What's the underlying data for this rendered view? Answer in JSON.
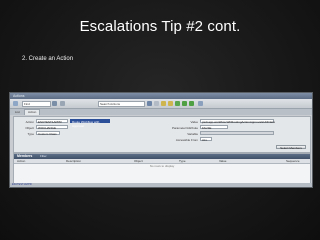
{
  "slide": {
    "title": "Escalations Tip #2 cont.",
    "subtitle": "2. Create an Action"
  },
  "app": {
    "window_title": "Actions",
    "toolbar": {
      "find_field": "Find",
      "search_field": "Search Actions"
    },
    "tabs": [
      {
        "label": "List"
      },
      {
        "label": "Action"
      }
    ],
    "form": {
      "action_label": "Action",
      "action_value": "ESCTEST1APPR",
      "action_desc": "Route Workflow with Approval",
      "object_label": "Object",
      "object_value": "WOCHANGE",
      "type_label": "Type",
      "type_value": "Custom Class",
      "value_label": "Value",
      "value_value": "psdi.app.workflow.WFRoutingActionApprovalsUtilClass",
      "parameter_label": "Parameter/Attribute",
      "parameter_value": "FALSE",
      "variable_label": "Variable",
      "accessible_label": "Accessible From",
      "accessible_value": "ALL",
      "select_button": "Select Members"
    },
    "members": {
      "title": "Members",
      "filter_label": "Filter",
      "columns": [
        "Action",
        "Description",
        "Object",
        "Type",
        "Value",
        "Sequence"
      ],
      "empty_text": "No rows to display"
    },
    "status_text": "ESCTEST1APPR"
  },
  "colors": {
    "slide_background": "#171717",
    "accent_blue": "#2c4f9a"
  }
}
